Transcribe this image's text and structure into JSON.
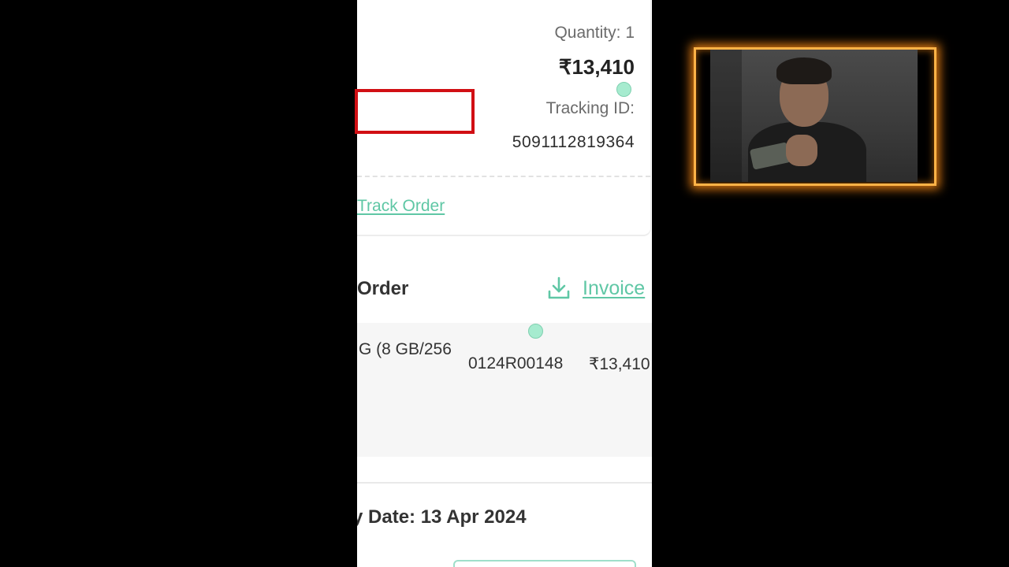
{
  "order_card": {
    "quantity_text": "Quantity: 1",
    "price": "₹13,410",
    "tracking_label": "Tracking ID:",
    "tracking_id": "5091112819364",
    "track_order_link": "Track Order"
  },
  "order_section": {
    "heading": "Order",
    "invoice_label": "Invoice",
    "item": {
      "name": "G (8 GB/256",
      "code": "0124R00148",
      "price": "₹13,410"
    }
  },
  "delivery": {
    "text": "y Date: 13 Apr 2024"
  },
  "icons": {
    "download": "download-icon"
  },
  "colors": {
    "accent_green": "#5fc7a5",
    "highlight_red": "#d10f14",
    "frame_orange": "#ffb347"
  }
}
